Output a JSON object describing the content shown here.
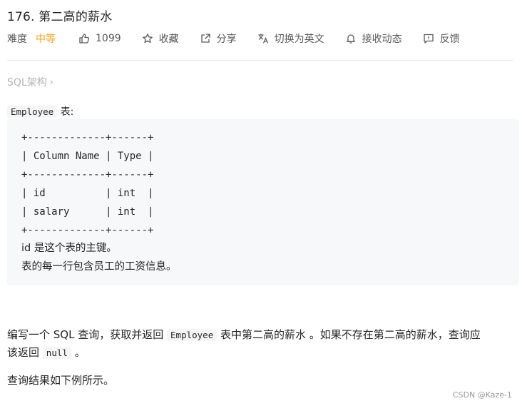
{
  "problem": {
    "title": "176. 第二高的薪水",
    "difficulty_label": "难度",
    "difficulty": "中等",
    "likes": "1099",
    "favorite": "收藏",
    "share": "分享",
    "switch_lang": "切换为英文",
    "notify": "接收动态",
    "feedback": "反馈"
  },
  "tag": {
    "label": "SQL架构",
    "chevron": "›"
  },
  "description": {
    "table_name": "Employee",
    "table_suffix": "表:",
    "schema_lines": [
      "+-------------+------+",
      "| Column Name | Type |",
      "+-------------+------+",
      "| id          | int  |",
      "| salary      | int  |",
      "+-------------+------+"
    ],
    "note_1": "id 是这个表的主键。",
    "note_2": "表的每一行包含员工的工资信息。",
    "task_pre": "编写一个 SQL 查询，获取并返回",
    "task_code": "Employee",
    "task_mid": "表中第二高的薪水 。如果不存在第二高的薪水，查询应",
    "task_line2_pre": "该返回",
    "task_null": "null",
    "task_line2_post": "。",
    "result_text": "查询结果如下例所示。"
  },
  "watermark": "CSDN @Kaze-1",
  "icons": [
    "thumbs-up-icon",
    "star-icon",
    "share-icon",
    "translate-icon",
    "bell-icon",
    "feedback-icon"
  ],
  "colors": {
    "difficulty_medium": "#ffa116",
    "code_bg": "#f7f8fa"
  }
}
